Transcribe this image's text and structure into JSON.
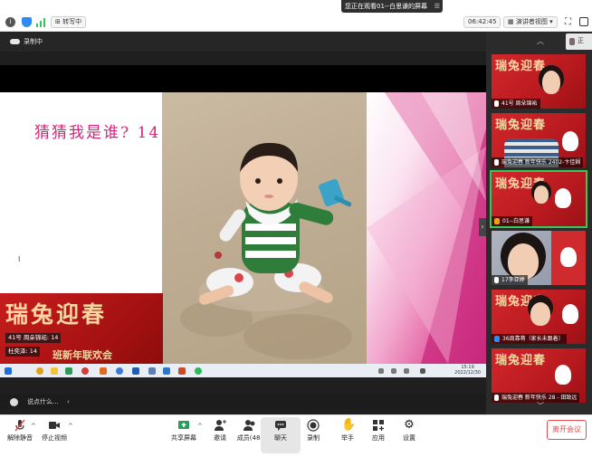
{
  "topbar": {
    "banner_text": "您正在观看01--白思谦的屏幕",
    "banner_close": "☰",
    "recording_pill": "转写中",
    "time": "06:42:45",
    "view_label": "演讲者视图",
    "colors": {
      "security": "#2d8cf0",
      "signal": "#34c759"
    }
  },
  "recording_status": "录制中",
  "slide": {
    "title": "猜猜我是谁? 14",
    "banner_title": "瑞兔迎春",
    "subtitle": "班新年联欢会",
    "speaker_1": "41号 周朵锦祏: 14",
    "speaker_2": "杜奕泽: 14"
  },
  "taskbar": {
    "time": "15:19",
    "date": "2022/12/30"
  },
  "chat": {
    "placeholder": "说点什么..."
  },
  "panel": {
    "thumb_title": "瑞兔迎春",
    "participants": [
      {
        "name": "41号 周朵锦祏"
      },
      {
        "name": "瑞兔迎春 新年快乐 2402-卞佳娴"
      },
      {
        "name": "01--白思谦"
      },
      {
        "name": "17李亚婷"
      },
      {
        "name": "36周靠蒋（家长未跟着）"
      },
      {
        "name": "瑞兔迎春 新年快乐 28 - 田致远"
      }
    ]
  },
  "toolbar": {
    "mute": "解除静音",
    "video": "停止视频",
    "share": "共享屏幕",
    "invite": "邀请",
    "members": "成员(48)",
    "chat": "聊天",
    "record": "录制",
    "raise_hand": "举手",
    "apps": "应用",
    "settings": "设置",
    "leave": "离开会议",
    "leave_color": "#e54d4d"
  }
}
